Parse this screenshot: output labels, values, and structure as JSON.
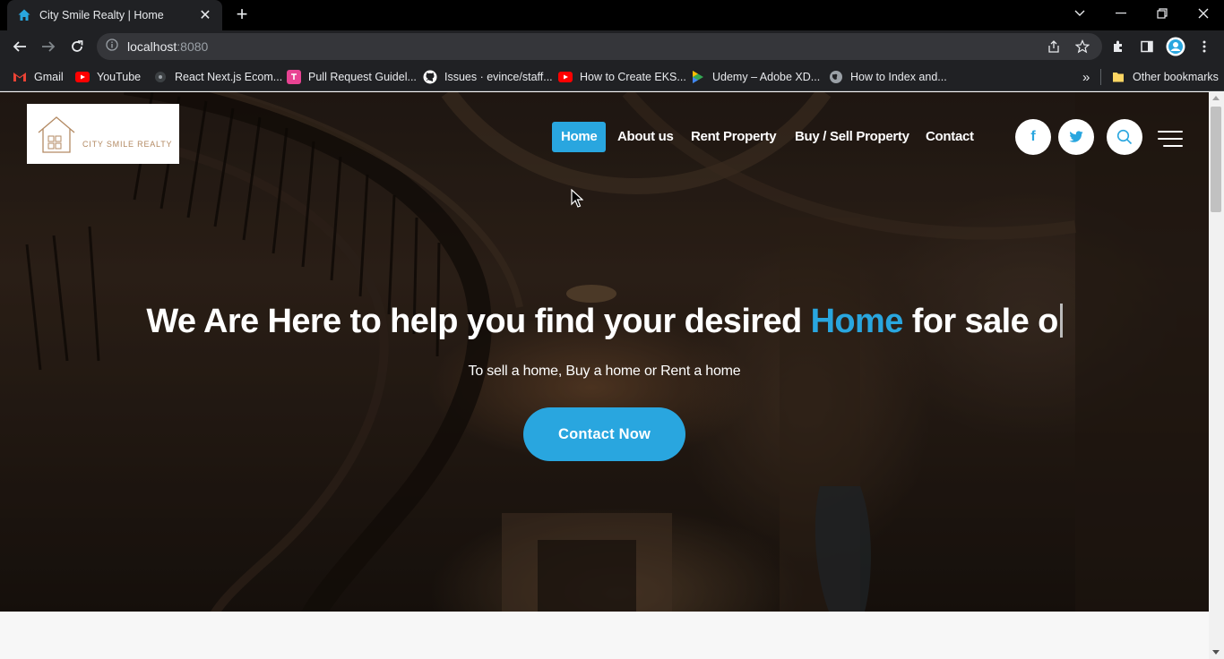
{
  "browser": {
    "tab_title": "City Smile Realty | Home",
    "tab_close": "✕",
    "new_tab": "+",
    "url_host": "localhost",
    "url_port": ":8080",
    "bookmarks": [
      {
        "label": "Gmail",
        "icon": "gmail-icon",
        "color": "#ea4335"
      },
      {
        "label": "YouTube",
        "icon": "youtube-icon",
        "color": "#ff0000"
      },
      {
        "label": "React Next.js Ecom...",
        "icon": "react-icon",
        "color": "#5f6368"
      },
      {
        "label": "Pull Request Guidel...",
        "icon": "pr-guide-icon",
        "color": "#e84393"
      },
      {
        "label": "Issues · evince/staff...",
        "icon": "github-icon",
        "color": "#ffffff"
      },
      {
        "label": "How to Create EKS...",
        "icon": "youtube-icon",
        "color": "#ff0000"
      },
      {
        "label": "Udemy – Adobe XD...",
        "icon": "udemy-icon",
        "color": "#34a853"
      },
      {
        "label": "How to Index and...",
        "icon": "globe-icon",
        "color": "#9aa0a6"
      }
    ],
    "bookmarks_overflow": "»",
    "other_bookmarks": "Other bookmarks"
  },
  "site": {
    "logo_text": "CITY SMILE REALTY",
    "nav": [
      {
        "label": "Home",
        "active": true
      },
      {
        "label": "About us",
        "active": false
      },
      {
        "label": "Rent Property",
        "active": false
      },
      {
        "label": "Buy / Sell Property",
        "active": false
      },
      {
        "label": "Contact",
        "active": false
      }
    ],
    "social_facebook": "f",
    "hero": {
      "headline_pre": "We Are Here to help you find your desired ",
      "headline_accent": "Home",
      "headline_post": " for sale o",
      "subheadline": "To sell a home, Buy a home or Rent a home",
      "cta_label": "Contact Now"
    },
    "colors": {
      "accent": "#29a6df",
      "logo_text": "#b38a63"
    }
  }
}
